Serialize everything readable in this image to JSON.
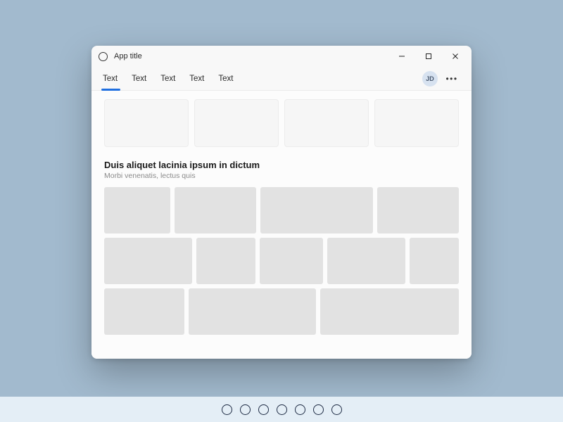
{
  "titlebar": {
    "title": "App title"
  },
  "tabs": [
    {
      "label": "Text",
      "active": true
    },
    {
      "label": "Text",
      "active": false
    },
    {
      "label": "Text",
      "active": false
    },
    {
      "label": "Text",
      "active": false
    },
    {
      "label": "Text",
      "active": false
    }
  ],
  "avatar": {
    "initials": "JD"
  },
  "section": {
    "title": "Duis aliquet lacinia ipsum in dictum",
    "subtitle": "Morbi venenatis, lectus quis"
  },
  "taskbar": {
    "items": 7
  },
  "colors": {
    "desktop": "#a2bace",
    "taskbar": "#e4eef6",
    "accent": "#1f6fe0"
  }
}
